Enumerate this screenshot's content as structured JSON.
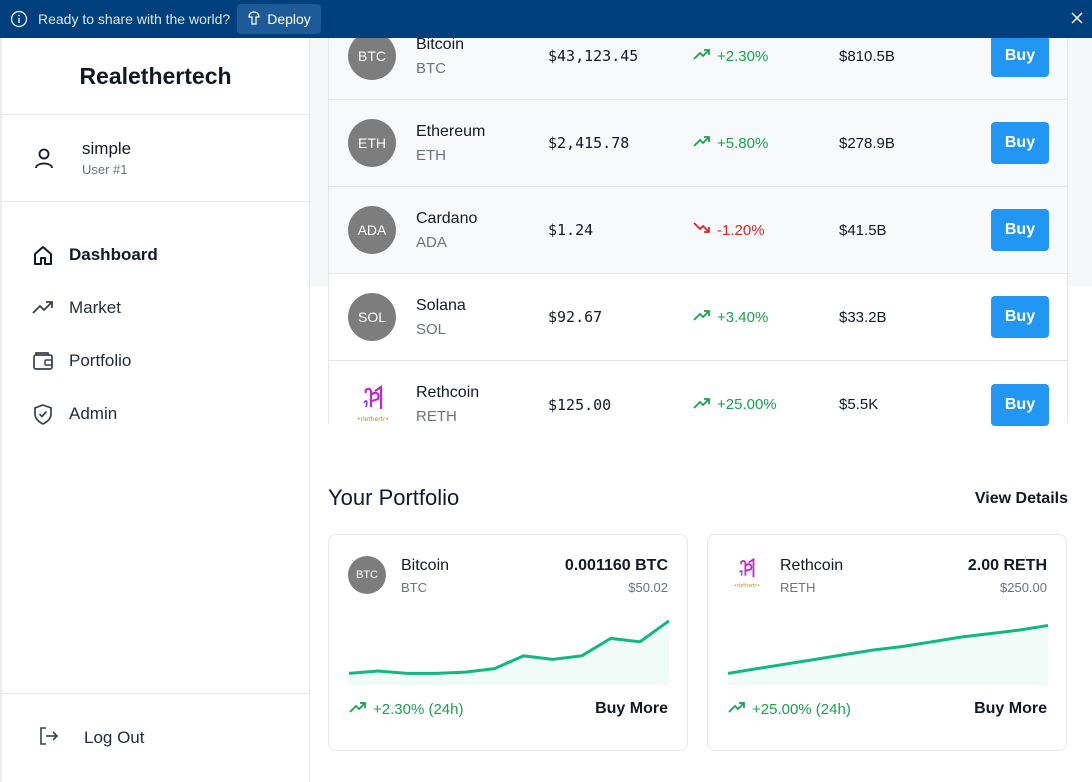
{
  "banner": {
    "message": "Ready to share with the world?",
    "deploy_label": "Deploy"
  },
  "sidebar": {
    "brand": "Realethertech",
    "user": {
      "name": "simple",
      "id_label": "User #1"
    },
    "items": [
      {
        "label": "Dashboard",
        "icon": "home-icon",
        "active": true
      },
      {
        "label": "Market",
        "icon": "trending-up-icon"
      },
      {
        "label": "Portfolio",
        "icon": "wallet-icon"
      },
      {
        "label": "Admin",
        "icon": "shield-icon"
      }
    ],
    "logout_label": "Log Out"
  },
  "market": {
    "rows": [
      {
        "avatar": "BTC",
        "name": "Bitcoin",
        "symbol": "BTC",
        "price": "$43,123.45",
        "change": "+2.30%",
        "direction": "up",
        "mcap": "$810.5B",
        "buy": "Buy"
      },
      {
        "avatar": "ETH",
        "name": "Ethereum",
        "symbol": "ETH",
        "price": "$2,415.78",
        "change": "+5.80%",
        "direction": "up",
        "mcap": "$278.9B",
        "buy": "Buy"
      },
      {
        "avatar": "ADA",
        "name": "Cardano",
        "symbol": "ADA",
        "price": "$1.24",
        "change": "-1.20%",
        "direction": "down",
        "mcap": "$41.5B",
        "buy": "Buy"
      },
      {
        "avatar": "SOL",
        "name": "Solana",
        "symbol": "SOL",
        "price": "$92.67",
        "change": "+3.40%",
        "direction": "up",
        "mcap": "$33.2B",
        "buy": "Buy"
      },
      {
        "avatar": "",
        "name": "Rethcoin",
        "symbol": "RETH",
        "price": "$125.00",
        "change": "+25.00%",
        "direction": "up",
        "mcap": "$5.5K",
        "buy": "Buy"
      }
    ]
  },
  "portfolio": {
    "title": "Your Portfolio",
    "view_details": "View Details",
    "cards": [
      {
        "avatar": "BTC",
        "name": "Bitcoin",
        "symbol": "BTC",
        "amount": "0.001160 BTC",
        "value": "$50.02",
        "change": "+2.30% (24h)",
        "buy_more": "Buy More",
        "spark": [
          10,
          12,
          10,
          10,
          11,
          14,
          25,
          22,
          25,
          40,
          37,
          55
        ]
      },
      {
        "avatar": "",
        "name": "Rethcoin",
        "symbol": "RETH",
        "amount": "2.00 RETH",
        "value": "$250.00",
        "change": "+25.00% (24h)",
        "buy_more": "Buy More",
        "spark": [
          10,
          14,
          18,
          22,
          26,
          30,
          33,
          37,
          41,
          44,
          47,
          51
        ]
      }
    ]
  },
  "colors": {
    "up": "#16a34a",
    "down": "#dc2626",
    "accent": "#2196f3",
    "banner": "#003f7d"
  }
}
